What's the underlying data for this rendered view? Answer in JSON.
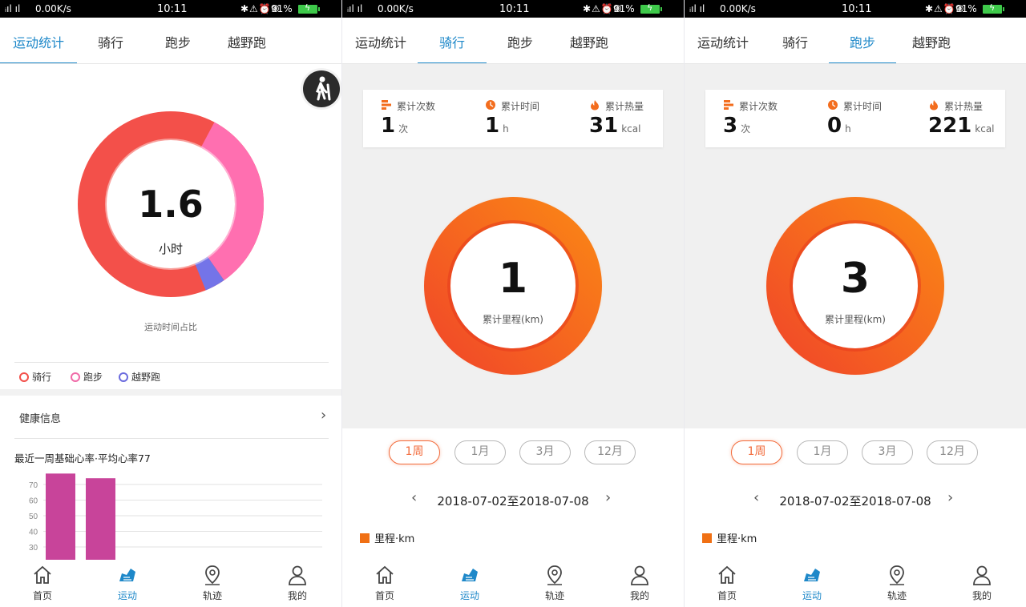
{
  "status_bar": {
    "signal": "⁨ᵢᵢᵢ46ᵢᵢᵢ⁩",
    "net_speed": "0.00K/s",
    "time": "10:11",
    "battery": "91%"
  },
  "tabs": [
    "运动统计",
    "骑行",
    "跑步",
    "越野跑"
  ],
  "bottom_nav": [
    "首页",
    "运动",
    "轨迹",
    "我的"
  ],
  "overview": {
    "total_hours": "1.6",
    "unit": "小时",
    "caption": "运动时间占比",
    "legend": [
      {
        "label": "骑行",
        "color": "#f3504a"
      },
      {
        "label": "跑步",
        "color": "#f06aa8"
      },
      {
        "label": "越野跑",
        "color": "#6b6bde"
      }
    ],
    "health_info": "健康信息",
    "heart_rate_title": "最近一周基础心率·平均心率77",
    "heart_rate_chart": {
      "y_ticks": [
        "70",
        "60",
        "50",
        "40",
        "30"
      ],
      "bars": [
        77,
        74
      ]
    }
  },
  "cycling": {
    "stats": [
      {
        "label": "累计次数",
        "value": "1",
        "unit": "次"
      },
      {
        "label": "累计时间",
        "value": "1",
        "unit": "h"
      },
      {
        "label": "累计热量",
        "value": "31",
        "unit": "kcal"
      }
    ],
    "distance": "1",
    "distance_label": "累计里程(km)",
    "periods": [
      "1周",
      "1月",
      "3月",
      "12月"
    ],
    "date_range": "2018-07-02至2018-07-08",
    "legend": "里程·km"
  },
  "running": {
    "stats": [
      {
        "label": "累计次数",
        "value": "3",
        "unit": "次"
      },
      {
        "label": "累计时间",
        "value": "0",
        "unit": "h"
      },
      {
        "label": "累计热量",
        "value": "221",
        "unit": "kcal"
      }
    ],
    "distance": "3",
    "distance_label": "累计里程(km)",
    "periods": [
      "1周",
      "1月",
      "3月",
      "12月"
    ],
    "date_range": "2018-07-02至2018-07-08",
    "legend": "里程·km"
  },
  "colors": {
    "accent": "#1e88c9",
    "ring_start": "#f0432a",
    "ring_end": "#fb8a14"
  }
}
